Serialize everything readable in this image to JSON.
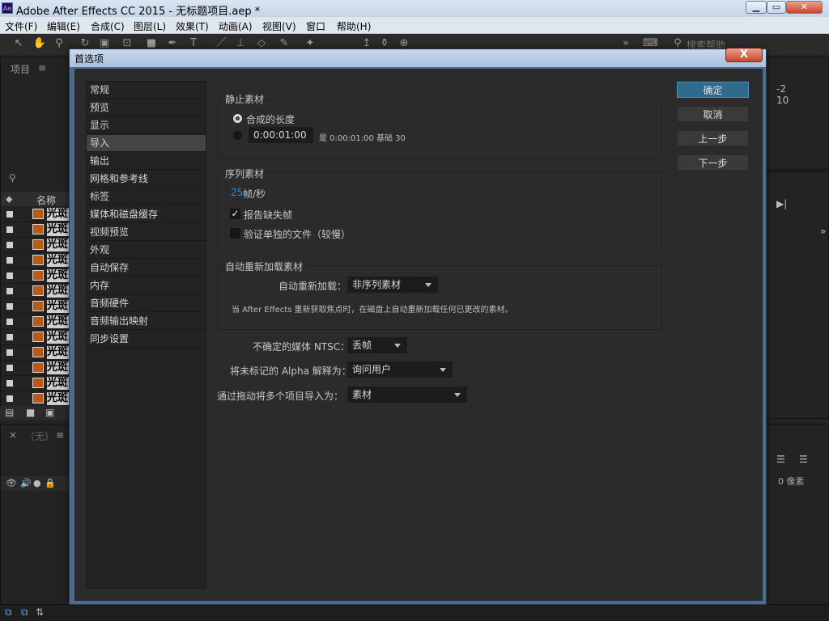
{
  "window": {
    "logo": "Ae",
    "title": "Adobe After Effects CC 2015 - 无标题项目.aep *",
    "controls": {
      "minimize": "▁",
      "maximize": "▭",
      "close": "✕"
    }
  },
  "menubar": [
    "文件(F)",
    "编辑(E)",
    "合成(C)",
    "图层(L)",
    "效果(T)",
    "动画(A)",
    "视图(V)",
    "窗口",
    "帮助(H)"
  ],
  "toolbar": {
    "search_placeholder": "搜索帮助"
  },
  "background": {
    "project_tab": "项目",
    "name_header": "名称",
    "item_name": "光斑",
    "timeline_tab": "（无）",
    "right_values": [
      "-2",
      "10"
    ],
    "pixels_label": "0 像素"
  },
  "dialog": {
    "title": "首选项",
    "close": "X",
    "categories": [
      {
        "label": "常规",
        "selected": false
      },
      {
        "label": "预览",
        "selected": false
      },
      {
        "label": "显示",
        "selected": false
      },
      {
        "label": "导入",
        "selected": true
      },
      {
        "label": "输出",
        "selected": false
      },
      {
        "label": "网格和参考线",
        "selected": false
      },
      {
        "label": "标签",
        "selected": false
      },
      {
        "label": "媒体和磁盘缓存",
        "selected": false
      },
      {
        "label": "视频预览",
        "selected": false
      },
      {
        "label": "外观",
        "selected": false
      },
      {
        "label": "自动保存",
        "selected": false
      },
      {
        "label": "内存",
        "selected": false
      },
      {
        "label": "音频硬件",
        "selected": false
      },
      {
        "label": "音频输出映射",
        "selected": false
      },
      {
        "label": "同步设置",
        "selected": false
      }
    ],
    "buttons": {
      "ok": "确定",
      "cancel": "取消",
      "prev": "上一步",
      "next": "下一步"
    },
    "still_footage": {
      "heading": "静止素材",
      "comp_length_label": "合成的长度",
      "comp_length_selected": true,
      "duration_value": "0:00:01:00",
      "duration_note": "是 0:00:01:00  基础 30"
    },
    "sequence_footage": {
      "heading": "序列素材",
      "fps_value": "25",
      "fps_unit": "帧/秒",
      "report_missing_label": "报告缺失帧",
      "report_missing_checked": true,
      "verify_files_label": "验证单独的文件（较慢）",
      "verify_files_checked": false
    },
    "auto_reload": {
      "heading": "自动重新加载素材",
      "label": "自动重新加载：",
      "value": "非序列素材",
      "note": "当 After Effects 重新获取焦点时，在磁盘上自动重新加载任何已更改的素材。"
    },
    "indeterminate_media": {
      "label": "不确定的媒体 NTSC：",
      "value": "丢帧"
    },
    "unlabeled_alpha": {
      "label": "将未标记的 Alpha 解释为：",
      "value": "询问用户"
    },
    "drag_import": {
      "label": "通过拖动将多个项目导入为：",
      "value": "素材"
    }
  },
  "colors": {
    "primary_button": "#2e6b8c",
    "link_value": "#2e8fd4"
  }
}
